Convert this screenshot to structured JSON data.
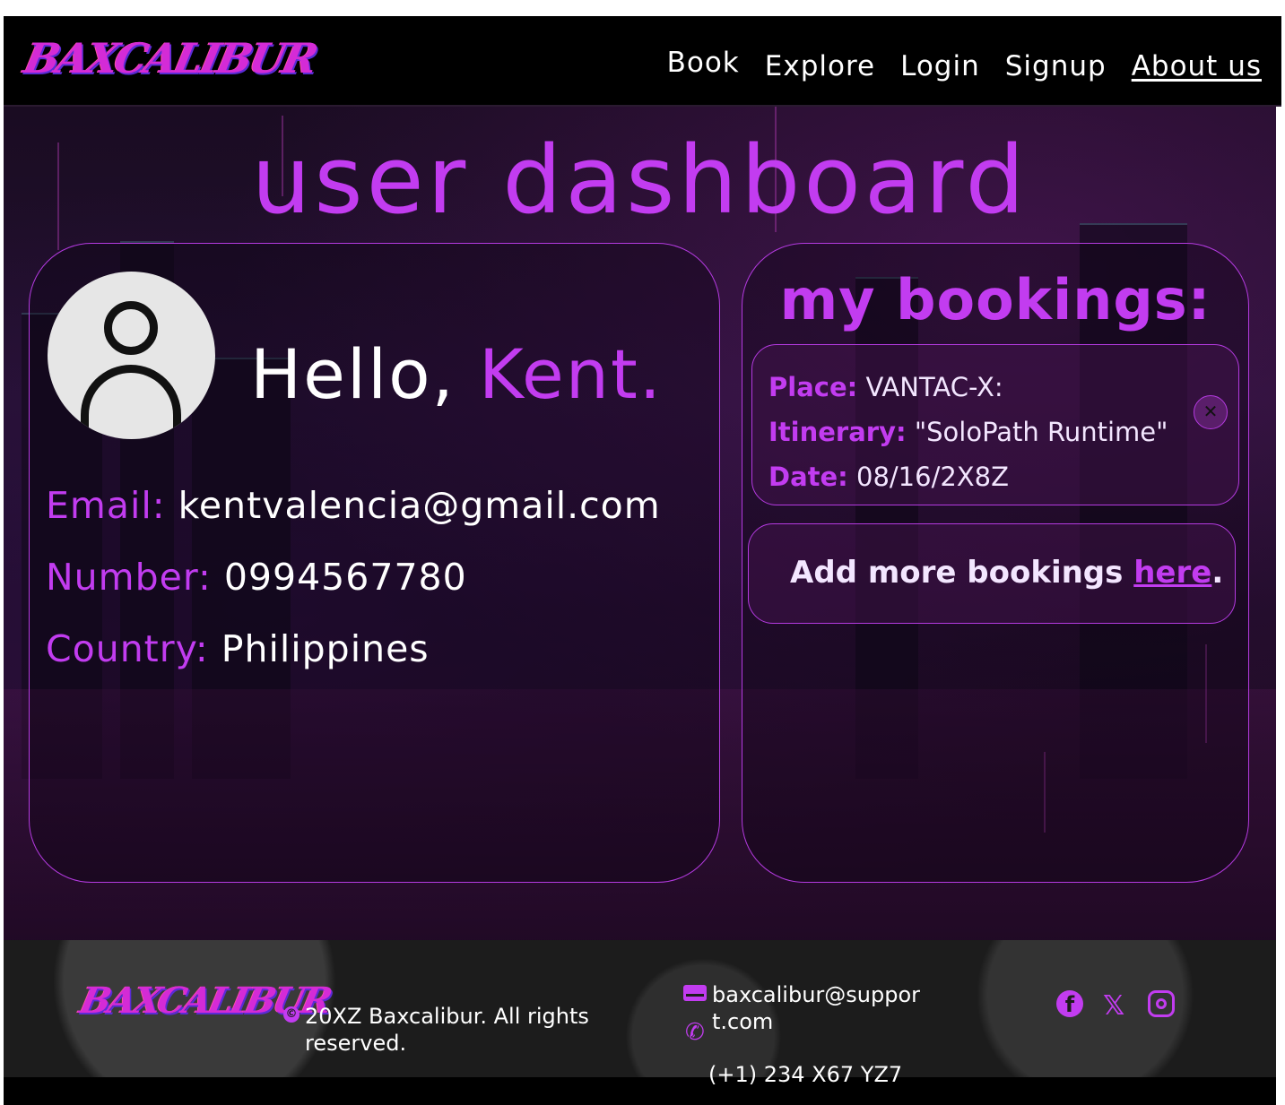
{
  "brand": {
    "logo_text": "BAXCALIBUR"
  },
  "nav": {
    "items": [
      {
        "label": "Book"
      },
      {
        "label": "Explore"
      },
      {
        "label": "Login"
      },
      {
        "label": "Signup"
      },
      {
        "label": "About us",
        "active": true
      }
    ]
  },
  "page": {
    "title": "user dashboard"
  },
  "profile": {
    "greeting": "Hello,",
    "name": "Kent.",
    "email_label": "Email:",
    "email": "kentvalencia@gmail.com",
    "number_label": "Number:",
    "number": "0994567780",
    "country_label": "Country:",
    "country": "Philippines"
  },
  "bookings": {
    "title": "my bookings:",
    "items": [
      {
        "place_label": "Place:",
        "place": "VANTAC-X:",
        "itinerary_label": "Itinerary:",
        "itinerary": "\"SoloPath Runtime\"",
        "date_label": "Date:",
        "date": "08/16/2X8Z",
        "remove_glyph": "✕"
      }
    ],
    "add_more_text": "Add more bookings ",
    "add_more_link": "here",
    "add_more_suffix": "."
  },
  "footer": {
    "logo_text": "BAXCALIBUR",
    "copyright_symbol": "©",
    "copyright": "20XZ Baxcalibur. All rights reserved.",
    "email": "baxcalibur@support.com",
    "phone": "(+1) 234 X67 YZ7",
    "social": [
      "facebook-icon",
      "x-icon",
      "instagram-icon"
    ]
  },
  "colors": {
    "accent": "#c23cf0",
    "nav_bg": "#000000",
    "text": "#ffffff"
  }
}
